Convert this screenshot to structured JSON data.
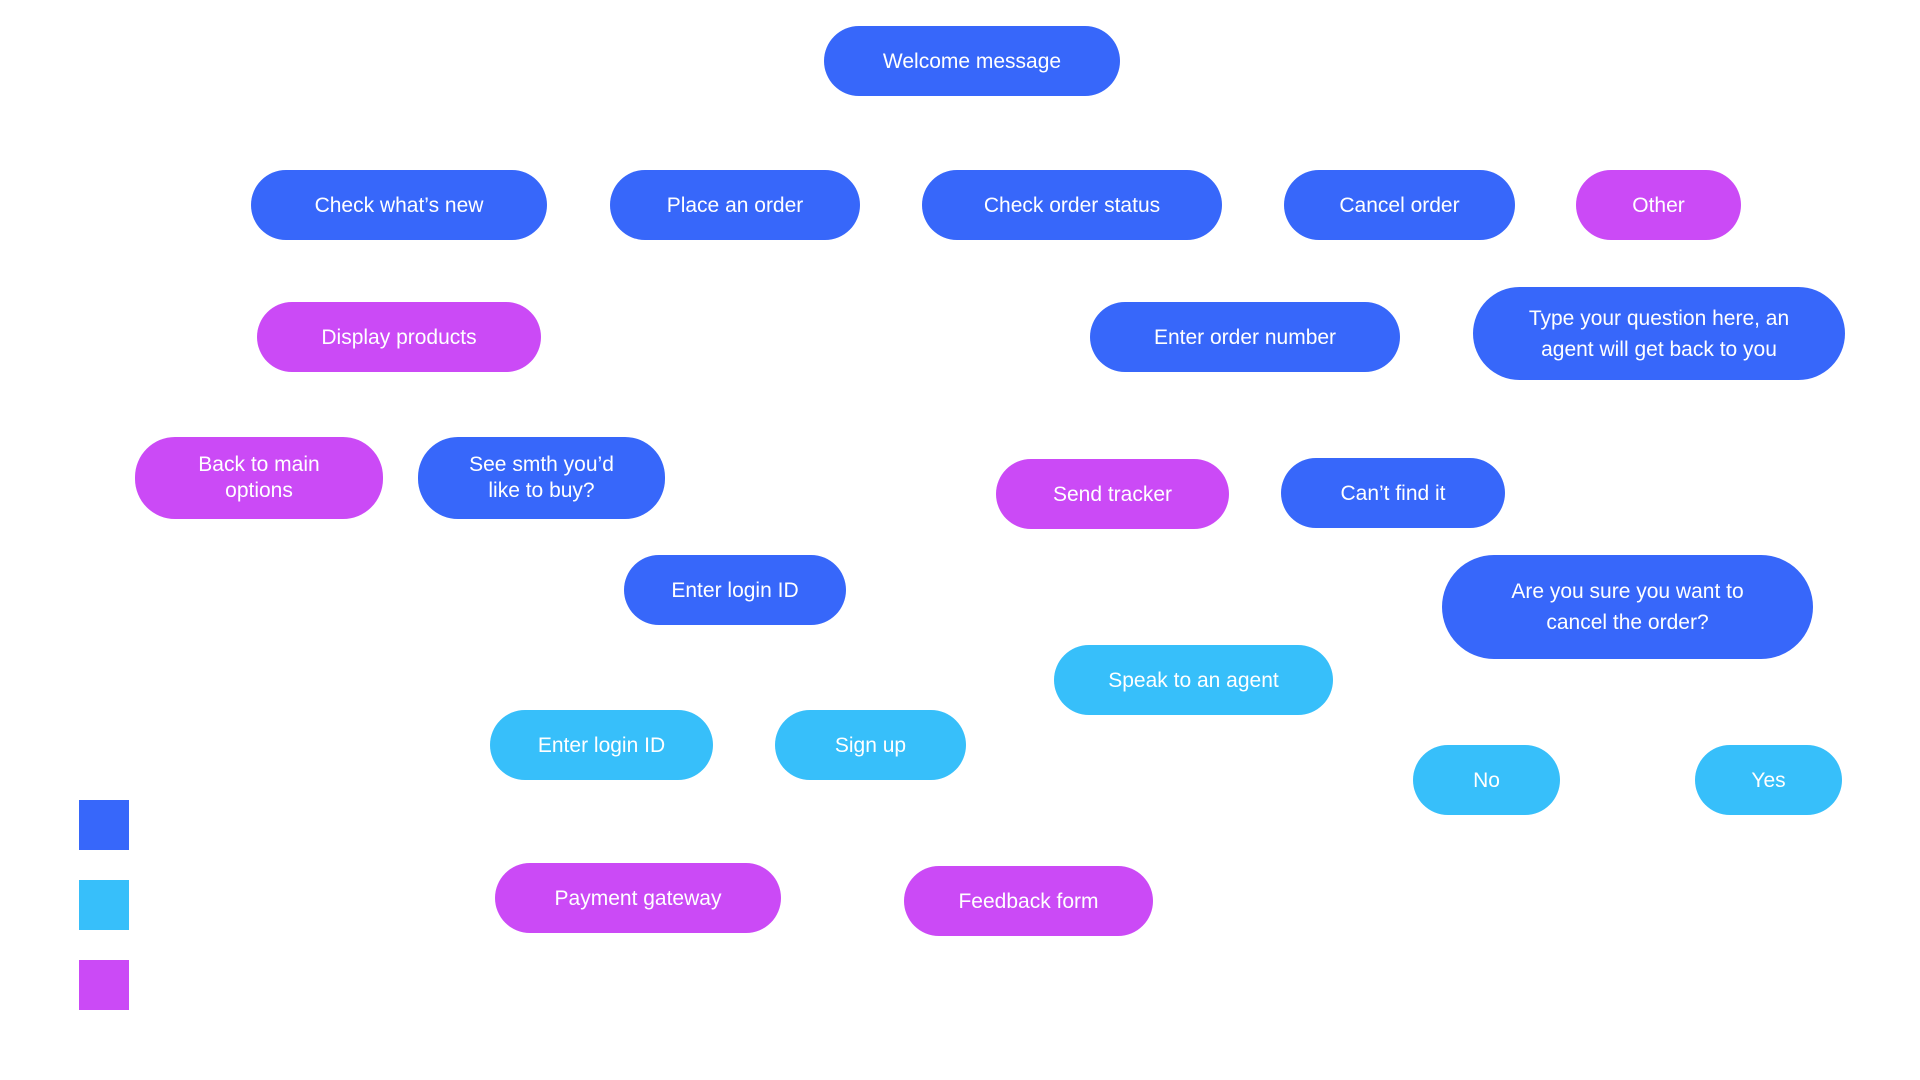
{
  "colors": {
    "blue": "#3767fa",
    "cyan": "#37bffa",
    "magenta": "#cb4af6"
  },
  "nodes": {
    "welcome": {
      "label": "Welcome message",
      "color": "blue"
    },
    "check_new": {
      "label": "Check what’s new",
      "color": "blue"
    },
    "place_order": {
      "label": "Place an order",
      "color": "blue"
    },
    "check_status": {
      "label": "Check order status",
      "color": "blue"
    },
    "cancel_order": {
      "label": "Cancel order",
      "color": "blue"
    },
    "other": {
      "label": "Other",
      "color": "magenta"
    },
    "display_products": {
      "label": "Display products",
      "color": "magenta"
    },
    "enter_order_number": {
      "label": "Enter order number",
      "color": "blue"
    },
    "type_question": {
      "label": "Type your question here, an agent will get back to you",
      "color": "blue"
    },
    "back_main": {
      "label": "Back to main options",
      "color": "magenta"
    },
    "see_smth": {
      "label": "See smth you’d like to buy?",
      "color": "blue"
    },
    "send_tracker": {
      "label": "Send tracker",
      "color": "magenta"
    },
    "cant_find": {
      "label": "Can’t find it",
      "color": "blue"
    },
    "enter_login_1": {
      "label": "Enter login ID",
      "color": "blue"
    },
    "are_you_sure": {
      "label": "Are you sure you want to cancel the order?",
      "color": "blue"
    },
    "speak_agent": {
      "label": "Speak to an agent",
      "color": "cyan"
    },
    "enter_login_2": {
      "label": "Enter login ID",
      "color": "cyan"
    },
    "sign_up": {
      "label": "Sign up",
      "color": "cyan"
    },
    "no": {
      "label": "No",
      "color": "cyan"
    },
    "yes": {
      "label": "Yes",
      "color": "cyan"
    },
    "payment_gateway": {
      "label": "Payment gateway",
      "color": "magenta"
    },
    "feedback_form": {
      "label": "Feedback form",
      "color": "magenta"
    }
  },
  "legend": [
    {
      "color": "blue"
    },
    {
      "color": "cyan"
    },
    {
      "color": "magenta"
    }
  ]
}
